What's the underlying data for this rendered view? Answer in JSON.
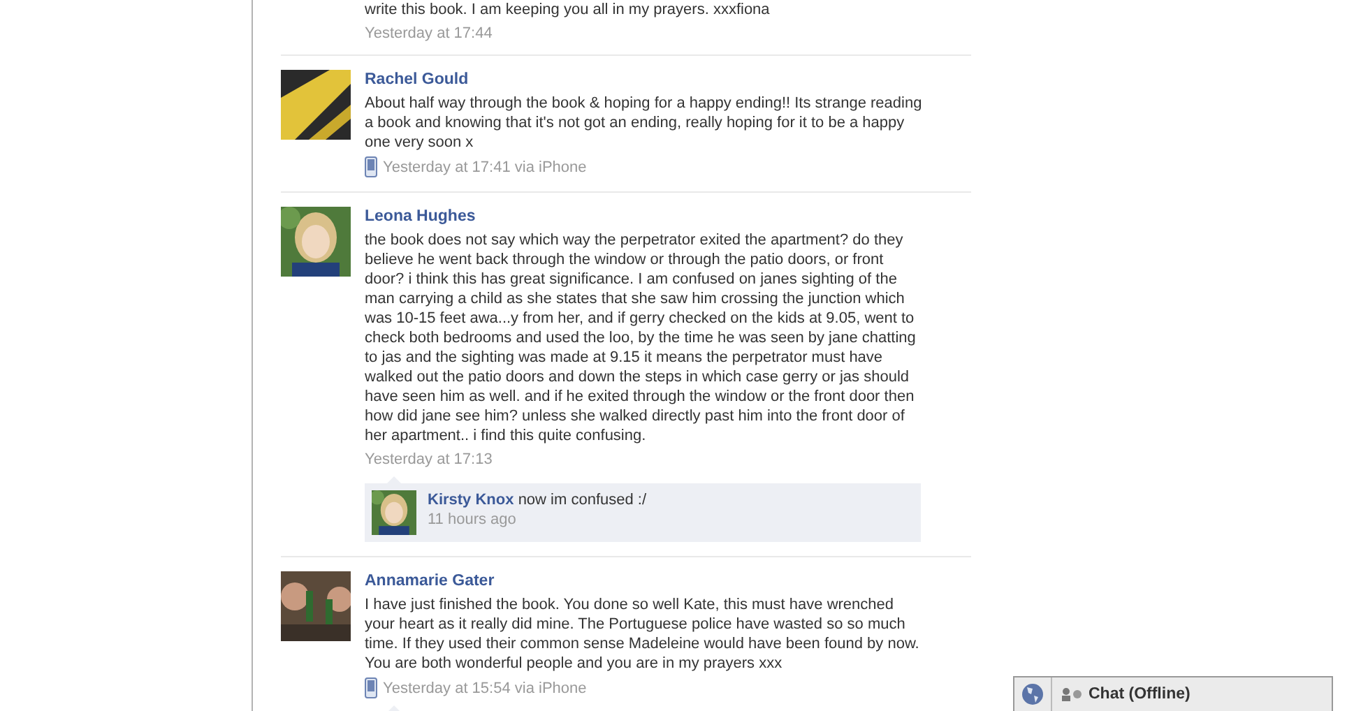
{
  "top_fragment": {
    "text": "write this book. I am keeping you all in my prayers. xxxfiona",
    "time": "Yesterday at 17:44"
  },
  "posts": [
    {
      "author": "Rachel Gould",
      "text": "About half way through the book & hoping for a happy ending!! Its strange reading a book and knowing that it's not got an ending, really hoping for it to be a happy one very soon x",
      "time": "Yesterday at 17:41 via iPhone",
      "via_mobile": true,
      "comment_box": false
    },
    {
      "author": "Leona Hughes",
      "text": "the book does not say which way the perpetrator exited the apartment? do they believe he went back through the window or through the patio doors, or front door? i think this has great significance. I am confused on janes sighting of the man carrying a child as she states that she saw him crossing the junction which was 10-15 feet awa...y from her, and if gerry checked on the kids at 9.05, went to check both bedrooms and used the loo, by the time he was seen by jane chatting to jas and the sighting was made at 9.15 it means the perpetrator must have walked out the patio doors and down the steps in which case gerry or jas should have seen him as well. and if he exited through the window or the front door then how did jane see him? unless she walked directly past him into the front door of her apartment.. i find this quite confusing.",
      "time": "Yesterday at 17:13",
      "via_mobile": false,
      "comment_box": true,
      "replies": [
        {
          "author": "Kirsty Knox",
          "text": "now im confused :/",
          "time": "11 hours ago"
        }
      ]
    },
    {
      "author": "Annamarie Gater",
      "text": "I have just finished the book. You done so well Kate, this must have wrenched your heart as it really did mine. The Portuguese police have wasted so so much time. If they used their common sense Madeleine would have been found by now. You are both wonderful people and you are in my prayers xxx",
      "time": "Yesterday at 15:54 via iPhone",
      "via_mobile": true,
      "comment_box": true
    }
  ],
  "chat": {
    "label": "Chat (Offline)"
  }
}
